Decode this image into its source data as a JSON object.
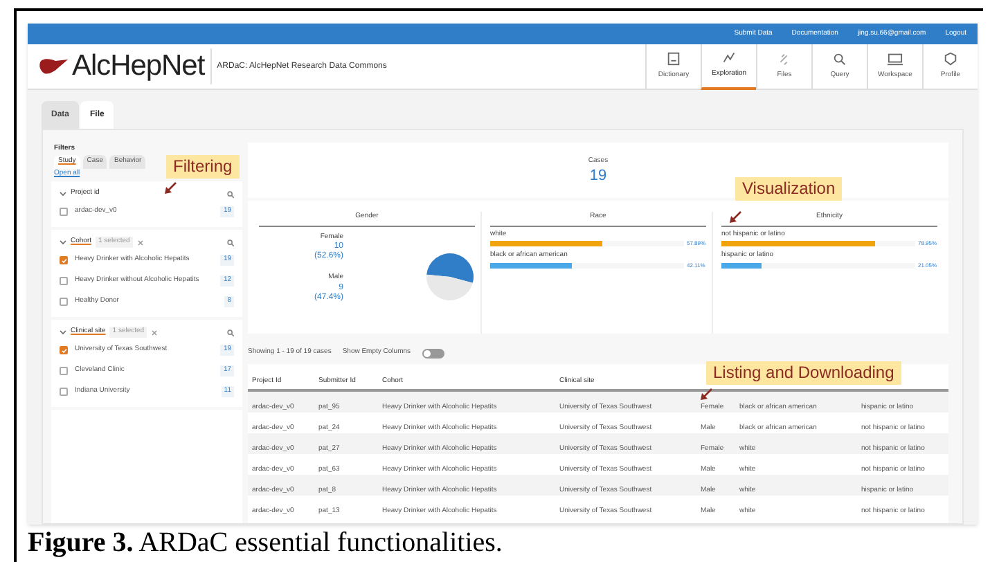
{
  "top_bar": {
    "links": [
      "Submit Data",
      "Documentation",
      "jing.su.66@gmail.com",
      "Logout"
    ]
  },
  "header": {
    "logo": "AlcHepNet",
    "subtitle": "ARDaC: AlcHepNet Research Data Commons",
    "nav": [
      {
        "label": "Dictionary",
        "selected": false
      },
      {
        "label": "Exploration",
        "selected": true
      },
      {
        "label": "Files",
        "selected": false
      },
      {
        "label": "Query",
        "selected": false
      },
      {
        "label": "Workspace",
        "selected": false
      },
      {
        "label": "Profile",
        "selected": false
      }
    ]
  },
  "tabs": [
    {
      "label": "Data",
      "selected": false
    },
    {
      "label": "File",
      "selected": true
    }
  ],
  "filters": {
    "title": "Filters",
    "tabs": [
      {
        "label": "Study",
        "selected": true
      },
      {
        "label": "Case",
        "selected": false
      },
      {
        "label": "Behavior",
        "selected": false
      }
    ],
    "open_all": "Open all",
    "sections": [
      {
        "title": "Project id",
        "items": [
          {
            "label": "ardac-dev_v0",
            "count": "19",
            "checked": false
          }
        ]
      },
      {
        "title": "Cohort",
        "selected_count": "1 selected",
        "items": [
          {
            "label": "Heavy Drinker with Alcoholic Hepatits",
            "count": "19",
            "checked": true
          },
          {
            "label": "Heavy Drinker without Alcoholic Hepatits",
            "count": "12",
            "checked": false
          },
          {
            "label": "Healthy Donor",
            "count": "8",
            "checked": false
          }
        ]
      },
      {
        "title": "Clinical site",
        "selected_count": "1 selected",
        "items": [
          {
            "label": "University of Texas Southwest",
            "count": "19",
            "checked": true
          },
          {
            "label": "Cleveland Clinic",
            "count": "17",
            "checked": false
          },
          {
            "label": "Indiana University",
            "count": "11",
            "checked": false
          }
        ]
      }
    ]
  },
  "summary": {
    "label": "Cases",
    "value": "19"
  },
  "gender": {
    "title": "Gender",
    "entries": [
      {
        "label": "Female",
        "value": "10",
        "percent": "(52.6%)",
        "color": "#2f7ec7"
      },
      {
        "label": "Male",
        "value": "9",
        "percent": "(47.4%)",
        "color": "#e8e8e8"
      }
    ]
  },
  "bar_panels": [
    {
      "title": "Race",
      "bars": [
        {
          "label": "white",
          "level": 0.5789,
          "reading": "57.89%",
          "color": "#f0a30a"
        },
        {
          "label": "black or african american",
          "level": 0.4211,
          "reading": "42.11%",
          "color": "#4aa8e8"
        }
      ]
    },
    {
      "title": "Ethnicity",
      "bars": [
        {
          "label": "not hispanic or latino",
          "level": 0.7895,
          "reading": "78.95%",
          "color": "#f0a30a"
        },
        {
          "label": "hispanic or latino",
          "level": 0.2105,
          "reading": "21.05%",
          "color": "#4aa8e8"
        }
      ]
    }
  ],
  "table": {
    "showing": "Showing 1 - 19 of 19 cases",
    "empty_columns_toggle": {
      "label": "Show Empty Columns",
      "on": false
    },
    "columns": [
      "Project Id",
      "Submitter Id",
      "Cohort",
      "Clinical site"
    ],
    "rows": [
      [
        "ardac-dev_v0",
        "pat_95",
        "Heavy Drinker with Alcoholic Hepatits",
        "University of Texas Southwest",
        "Female",
        "black or african american",
        "hispanic or latino"
      ],
      [
        "ardac-dev_v0",
        "pat_24",
        "Heavy Drinker with Alcoholic Hepatits",
        "University of Texas Southwest",
        "Male",
        "black or african american",
        "not hispanic or latino"
      ],
      [
        "ardac-dev_v0",
        "pat_27",
        "Heavy Drinker with Alcoholic Hepatits",
        "University of Texas Southwest",
        "Female",
        "white",
        "not hispanic or latino"
      ],
      [
        "ardac-dev_v0",
        "pat_63",
        "Heavy Drinker with Alcoholic Hepatits",
        "University of Texas Southwest",
        "Male",
        "white",
        "not hispanic or latino"
      ],
      [
        "ardac-dev_v0",
        "pat_8",
        "Heavy Drinker with Alcoholic Hepatits",
        "University of Texas Southwest",
        "Male",
        "white",
        "hispanic or latino"
      ],
      [
        "ardac-dev_v0",
        "pat_13",
        "Heavy Drinker with Alcoholic Hepatits",
        "University of Texas Southwest",
        "Male",
        "white",
        "not hispanic or latino"
      ]
    ]
  },
  "annotations": [
    "Filtering",
    "Visualization",
    "Listing and Downloading"
  ],
  "caption": "**Figure 3.** ARDaC essential functionalities."
}
